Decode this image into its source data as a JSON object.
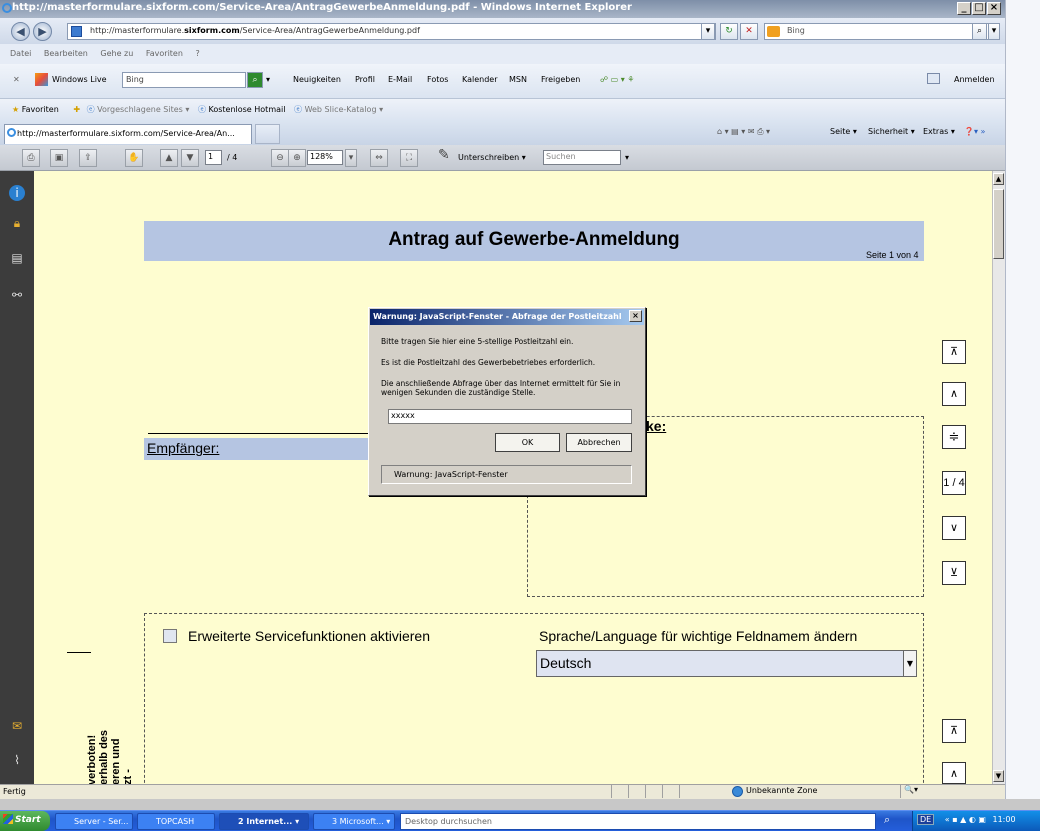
{
  "window": {
    "title": "http://masterformulare.sixform.com/Service-Area/AntragGewerbeAnmeldung.pdf - Windows Internet Explorer",
    "btn_min": "_",
    "btn_max": "□",
    "btn_close": "×"
  },
  "address_bar": {
    "url_prefix": "http://masterformulare.",
    "url_bold": "sixform.com",
    "url_suffix": "/Service-Area/AntragGewerbeAnmeldung.pdf",
    "search_value": "Bing"
  },
  "menu": [
    "Datei",
    "Bearbeiten",
    "Gehe zu",
    "Favoriten",
    "?"
  ],
  "windows_live": {
    "label": "Windows Live",
    "search_value": "Bing",
    "links": [
      "Neuigkeiten",
      "Profil",
      "E-Mail",
      "Fotos",
      "Kalender",
      "MSN",
      "Freigeben"
    ],
    "signin": "Anmelden"
  },
  "favorites": {
    "label": "Favoriten",
    "items": [
      "Vorgeschlagene Sites ▾",
      "Kostenlose Hotmail",
      "Web Slice-Katalog ▾"
    ]
  },
  "tab": {
    "label": "http://masterformulare.sixform.com/Service-Area/An..."
  },
  "command_bar": [
    "Seite ▾",
    "Sicherheit ▾",
    "Extras ▾"
  ],
  "pdf_toolbar": {
    "page_current": "1",
    "page_total": "/ 4",
    "zoom": "128%",
    "sign_label": "Unterschreiben ▾",
    "search_placeholder": "Suchen"
  },
  "document": {
    "title": "Antrag auf Gewerbe-Anmeldung",
    "page_info": "Seite 1 von 4",
    "recipient_label": "Empfänger:",
    "right_box_label": "ke:",
    "service_checkbox_label": "Erweiterte Servicefunktionen aktivieren",
    "language_label": "Sprache/Language für wichtige Feldnamem ändern",
    "language_value": "Deutsch",
    "vertical_text": [
      "zt -",
      "eren und",
      "erhalb des",
      "verboten!"
    ]
  },
  "side_nav": {
    "first": "⊼",
    "prev": "∧",
    "toggle": "≑",
    "page": "1 / 4",
    "next": "∨",
    "last": "⊻",
    "first2": "⊼",
    "prev2": "∧"
  },
  "dialog": {
    "title": "Warnung: JavaScript-Fenster - Abfrage der Postleitzahl",
    "line1": "Bitte tragen Sie hier eine 5-stellige Postleitzahl ein.",
    "line2": "Es ist die Postleitzahl des Gewerbebetriebes erforderlich.",
    "line3": "Die anschließende Abfrage über das Internet ermittelt für Sie in wenigen Sekunden die zuständige Stelle.",
    "input_value": "xxxxx",
    "ok": "OK",
    "cancel": "Abbrechen",
    "status": "Warnung: JavaScript-Fenster"
  },
  "status_bar": {
    "text": "Fertig",
    "zone": "Unbekannte Zone"
  },
  "taskbar": {
    "start": "Start",
    "items": [
      "Server - Ser...",
      "TOPCASH",
      "2 Internet... ▾",
      "3 Microsoft... ▾"
    ],
    "desktop_search": "Desktop durchsuchen",
    "lang": "DE",
    "clock": "11:00"
  },
  "colors": {
    "page_bg": "#fefdd0",
    "header_bar": "#b5c5e2",
    "title_bar": "#0a246a"
  }
}
